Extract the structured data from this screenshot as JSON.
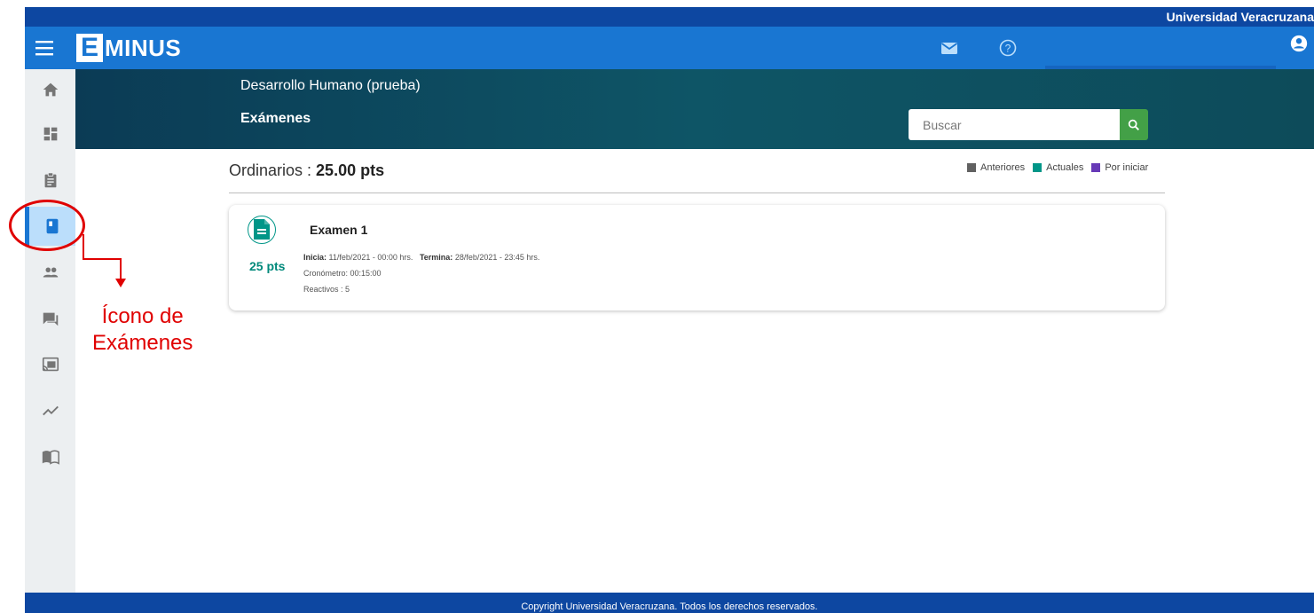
{
  "university_bar": {
    "name": "Universidad Veracruzana"
  },
  "header": {
    "logo_letter": "E",
    "logo_text": "MINUS",
    "icons": [
      "menu-icon",
      "mail-icon",
      "help-icon",
      "user-icon"
    ]
  },
  "sidebar": {
    "items": [
      {
        "icon": "home-icon"
      },
      {
        "icon": "dashboard-icon"
      },
      {
        "icon": "assignment-icon"
      },
      {
        "icon": "exam-book-icon",
        "active": true
      },
      {
        "icon": "people-icon"
      },
      {
        "icon": "forum-icon"
      },
      {
        "icon": "cast-icon"
      },
      {
        "icon": "trending-icon"
      },
      {
        "icon": "open-book-icon"
      }
    ]
  },
  "banner": {
    "course_name": "Desarrollo Humano (prueba)",
    "section_title": "Exámenes",
    "search_placeholder": "Buscar"
  },
  "content": {
    "ordinarios_label": "Ordinarios : ",
    "ordinarios_value": "25.00 pts",
    "legend": [
      {
        "label": "Anteriores",
        "color": "#616161"
      },
      {
        "label": "Actuales",
        "color": "#009688"
      },
      {
        "label": "Por iniciar",
        "color": "#673ab7"
      }
    ],
    "exam": {
      "title": "Examen 1",
      "points": "25 pts",
      "start_label": "Inicia:",
      "start_value": "11/feb/2021 - 00:00 hrs.",
      "end_label": "Termina:",
      "end_value": "28/feb/2021 - 23:45 hrs.",
      "timer": "Cronómetro: 00:15:00",
      "items": "Reactivos : 5"
    }
  },
  "annotation": {
    "line1": "Ícono de",
    "line2": "Exámenes",
    "color": "#e00000"
  },
  "footer": {
    "copyright": "Copyright Universidad Veracruzana. Todos los derechos reservados."
  }
}
